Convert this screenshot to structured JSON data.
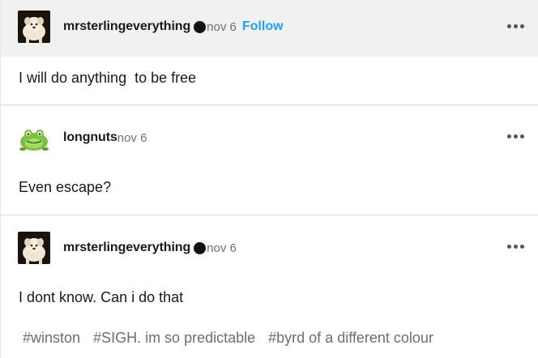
{
  "posts": [
    {
      "username": "mrsterlingeverything",
      "date": "nov 6",
      "follow_label": "Follow",
      "text": "I will do anything  to be free",
      "avatar": "dog-avatar"
    },
    {
      "username": "longnuts",
      "date": "nov 6",
      "text": "Even escape?",
      "avatar": "frog-avatar"
    },
    {
      "username": "mrsterlingeverything",
      "date": "nov 6",
      "text": "I dont know. Can i do that",
      "avatar": "dog-avatar",
      "tags": [
        "#winston",
        "#SIGH. im so predictable",
        "#byrd of a different colour"
      ]
    }
  ],
  "colors": {
    "follow": "#1aa3ff",
    "header_bg": "#f1f1f1",
    "tag": "#6e6e6e"
  }
}
